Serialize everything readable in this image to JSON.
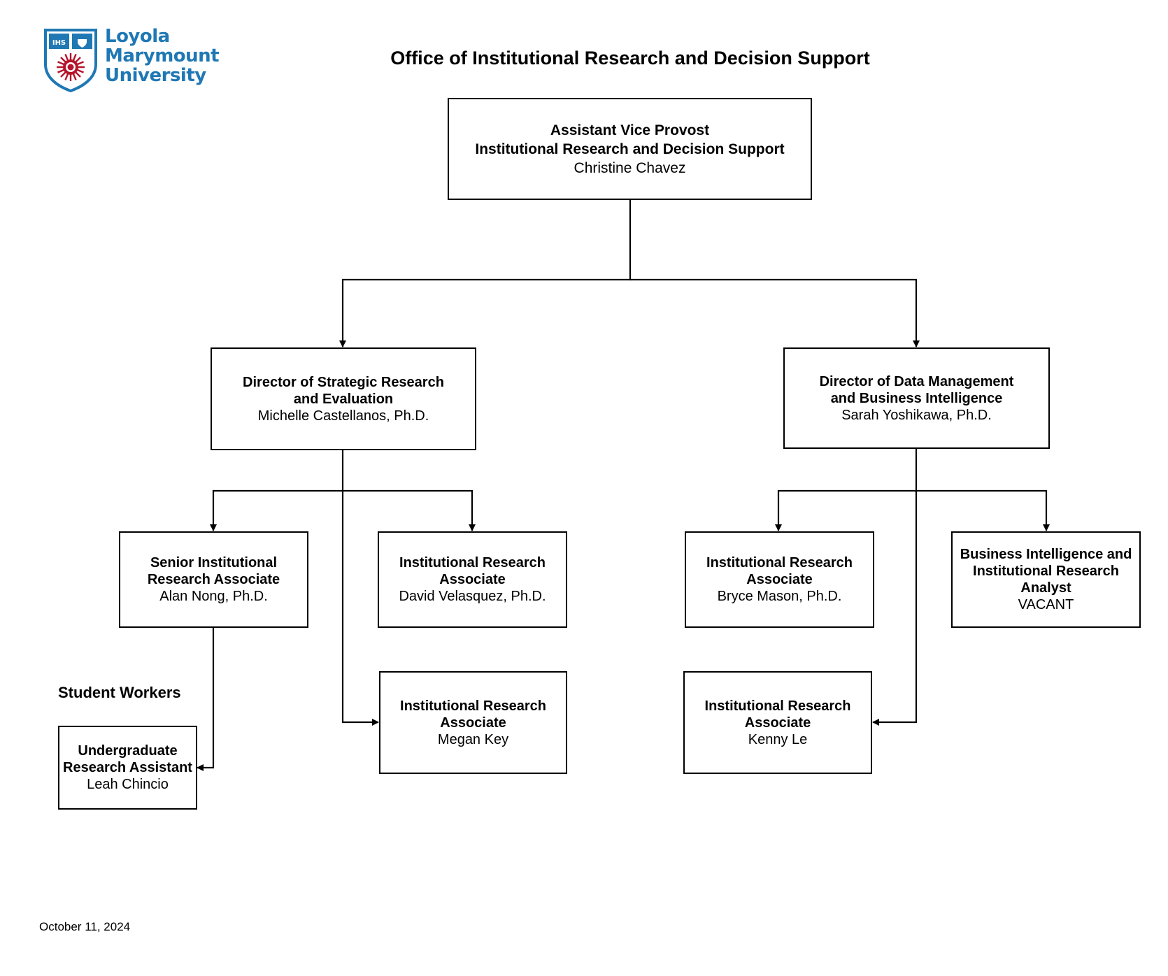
{
  "logo": {
    "name": "Loyola Marymount University",
    "lines": [
      "Loyola",
      "Marymount",
      "University"
    ],
    "colors": {
      "blue": "#1f78b4",
      "red": "#b5142b"
    }
  },
  "title": "Office of Institutional Research and Decision Support",
  "nodes": {
    "avp": {
      "title_lines": [
        "Assistant Vice Provost",
        "Institutional Research and Decision Support"
      ],
      "name": "Christine Chavez"
    },
    "dir_strategic": {
      "title_lines": [
        "Director of Strategic Research",
        "and Evaluation"
      ],
      "name": "Michelle Castellanos, Ph.D."
    },
    "dir_data": {
      "title_lines": [
        "Director of Data Management",
        "and Business Intelligence"
      ],
      "name": "Sarah Yoshikawa, Ph.D."
    },
    "senior_ira": {
      "title_lines": [
        "Senior Institutional",
        "Research Associate"
      ],
      "name": "Alan Nong, Ph.D."
    },
    "ira_david": {
      "title_lines": [
        "Institutional Research",
        "Associate"
      ],
      "name": "David Velasquez, Ph.D."
    },
    "ira_megan": {
      "title_lines": [
        "Institutional Research",
        "Associate"
      ],
      "name": "Megan Key"
    },
    "ira_bryce": {
      "title_lines": [
        "Institutional Research",
        "Associate"
      ],
      "name": "Bryce Mason, Ph.D."
    },
    "bi_analyst": {
      "title_lines": [
        "Business Intelligence and",
        "Institutional Research",
        "Analyst"
      ],
      "name": "VACANT"
    },
    "ira_kenny": {
      "title_lines": [
        "Institutional Research",
        "Associate"
      ],
      "name": "Kenny Le"
    },
    "ugrad_ra": {
      "title_lines": [
        "Undergraduate",
        "Research Assistant"
      ],
      "name": "Leah Chincio"
    }
  },
  "reporting": [
    {
      "from": "avp",
      "to": "dir_strategic"
    },
    {
      "from": "avp",
      "to": "dir_data"
    },
    {
      "from": "dir_strategic",
      "to": "senior_ira"
    },
    {
      "from": "dir_strategic",
      "to": "ira_david"
    },
    {
      "from": "dir_strategic",
      "to": "ira_megan"
    },
    {
      "from": "senior_ira",
      "to": "ugrad_ra"
    },
    {
      "from": "dir_data",
      "to": "ira_bryce"
    },
    {
      "from": "dir_data",
      "to": "bi_analyst"
    },
    {
      "from": "dir_data",
      "to": "ira_kenny"
    }
  ],
  "student_workers_label": "Student Workers",
  "date": "October 11, 2024"
}
